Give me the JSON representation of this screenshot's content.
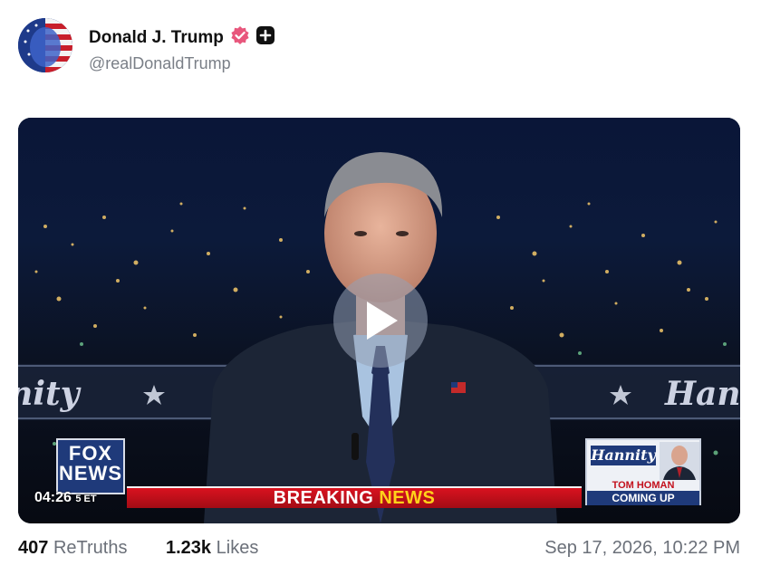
{
  "post": {
    "author": {
      "display_name": "Donald J. Trump",
      "handle": "@realDonaldTrump",
      "verified_icon": "verified-badge-icon",
      "extra_icon": "plus-square-icon"
    },
    "media": {
      "type": "video",
      "play_icon": "play-icon",
      "overlay": {
        "banner_left": "nnity",
        "banner_right": "Han",
        "network_logo_line1": "FOX",
        "network_logo_line2": "NEWS",
        "clock": "04:26",
        "clock_suffix": "5 ET",
        "breaking_word1": "BREAKING",
        "breaking_word2": "NEWS",
        "promo_show": "Hannity",
        "promo_name": "TOM HOMAN",
        "promo_coming": "COMING UP"
      }
    },
    "stats": {
      "retruths_count": "407",
      "retruths_label": "ReTruths",
      "likes_count": "1.23k",
      "likes_label": "Likes"
    },
    "timestamp": "Sep 17, 2026, 10:22 PM"
  },
  "colors": {
    "verified": "#e8567c",
    "breaking_red": "#d9121f",
    "breaking_yellow": "#ffd21a",
    "fox_blue": "#1f3a7a"
  }
}
